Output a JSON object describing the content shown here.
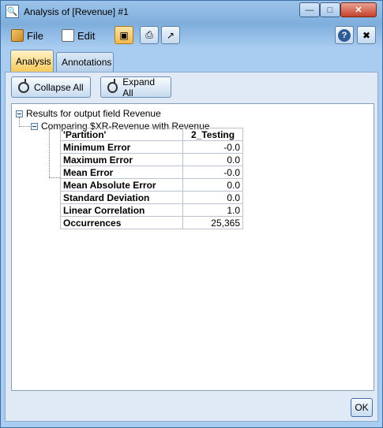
{
  "window": {
    "title": "Analysis of [Revenue] #1"
  },
  "menu": {
    "file": "File",
    "edit": "Edit"
  },
  "tabs": [
    {
      "label": "Analysis",
      "active": true
    },
    {
      "label": "Annotations",
      "active": false
    }
  ],
  "actions": {
    "collapse_all": "Collapse All",
    "expand_all": "Expand All"
  },
  "tree": {
    "root_label": "Results for output field Revenue",
    "child_label": "Comparing $XR-Revenue with Revenue"
  },
  "table": {
    "header": [
      "'Partition'",
      "2_Testing"
    ],
    "rows": [
      {
        "label": "Minimum Error",
        "value": "-0.0"
      },
      {
        "label": "Maximum Error",
        "value": "0.0"
      },
      {
        "label": "Mean Error",
        "value": "-0.0"
      },
      {
        "label": "Mean Absolute Error",
        "value": "0.0"
      },
      {
        "label": "Standard Deviation",
        "value": "0.0"
      },
      {
        "label": "Linear Correlation",
        "value": "1.0"
      },
      {
        "label": "Occurrences",
        "value": "25,365"
      }
    ]
  },
  "footer": {
    "ok": "OK"
  },
  "icons": {
    "window": "magnifier-icon",
    "help": "help-icon",
    "close_tools": "close-tools-icon"
  }
}
